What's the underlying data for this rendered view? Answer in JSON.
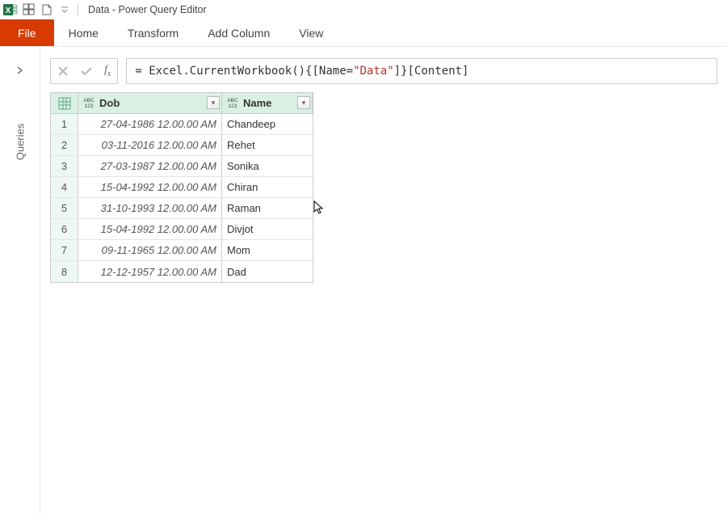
{
  "window": {
    "title": "Data - Power Query Editor"
  },
  "ribbon": {
    "file": "File",
    "tabs": [
      "Home",
      "Transform",
      "Add Column",
      "View"
    ]
  },
  "sidebar": {
    "label": "Queries"
  },
  "formula": {
    "prefix": "= Excel.CurrentWorkbook(){[Name=",
    "literal": "\"Data\"",
    "suffix": "]}[Content]"
  },
  "grid": {
    "type_label": "ABC\n123",
    "columns": [
      "Dob",
      "Name"
    ],
    "rows": [
      {
        "n": "1",
        "dob": "27-04-1986 12.00.00 AM",
        "name": "Chandeep"
      },
      {
        "n": "2",
        "dob": "03-11-2016 12.00.00 AM",
        "name": "Rehet"
      },
      {
        "n": "3",
        "dob": "27-03-1987 12.00.00 AM",
        "name": "Sonika"
      },
      {
        "n": "4",
        "dob": "15-04-1992 12.00.00 AM",
        "name": "Chiran"
      },
      {
        "n": "5",
        "dob": "31-10-1993 12.00.00 AM",
        "name": "Raman"
      },
      {
        "n": "6",
        "dob": "15-04-1992 12.00.00 AM",
        "name": "Divjot"
      },
      {
        "n": "7",
        "dob": "09-11-1965 12.00.00 AM",
        "name": "Mom"
      },
      {
        "n": "8",
        "dob": "12-12-1957 12.00.00 AM",
        "name": "Dad"
      }
    ]
  }
}
